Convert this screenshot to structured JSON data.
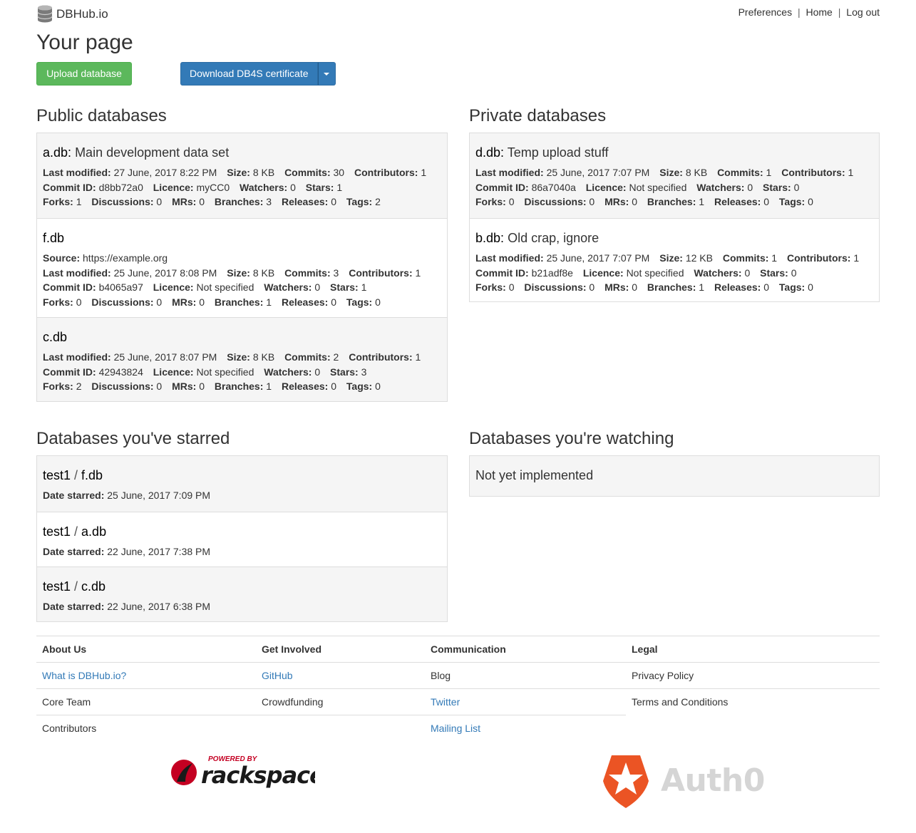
{
  "site": {
    "name": "DBHub.io"
  },
  "topnav": {
    "preferences": "Preferences",
    "home": "Home",
    "logout": "Log out",
    "separator": "|"
  },
  "page": {
    "title": "Your page"
  },
  "buttons": {
    "upload": "Upload database",
    "download_cert": "Download DB4S certificate"
  },
  "labels": {
    "last_modified": "Last modified:",
    "size": "Size:",
    "commits": "Commits:",
    "contributors": "Contributors:",
    "commit_id": "Commit ID:",
    "licence": "Licence:",
    "watchers": "Watchers:",
    "stars": "Stars:",
    "forks": "Forks:",
    "discussions": "Discussions:",
    "mrs": "MRs:",
    "branches": "Branches:",
    "releases": "Releases:",
    "tags": "Tags:",
    "source": "Source:",
    "date_starred": "Date starred:"
  },
  "public": {
    "heading": "Public databases",
    "items": [
      {
        "name": "a.db",
        "sep": ": ",
        "desc": "Main development data set",
        "last_modified": "27 June, 2017 8:22 PM",
        "size": "8 KB",
        "commits": "30",
        "contributors": "1",
        "commit_id": "d8bb72a0",
        "licence": "myCC0",
        "watchers": "0",
        "stars": "1",
        "forks": "1",
        "discussions": "0",
        "mrs": "0",
        "branches": "3",
        "releases": "0",
        "tags": "2"
      },
      {
        "name": "f.db",
        "source": "https://example.org",
        "last_modified": "25 June, 2017 8:08 PM",
        "size": "8 KB",
        "commits": "3",
        "contributors": "1",
        "commit_id": "b4065a97",
        "licence": "Not specified",
        "watchers": "0",
        "stars": "1",
        "forks": "0",
        "discussions": "0",
        "mrs": "0",
        "branches": "1",
        "releases": "0",
        "tags": "0"
      },
      {
        "name": "c.db",
        "last_modified": "25 June, 2017 8:07 PM",
        "size": "8 KB",
        "commits": "2",
        "contributors": "1",
        "commit_id": "42943824",
        "licence": "Not specified",
        "watchers": "0",
        "stars": "3",
        "forks": "2",
        "discussions": "0",
        "mrs": "0",
        "branches": "1",
        "releases": "0",
        "tags": "0"
      }
    ]
  },
  "private": {
    "heading": "Private databases",
    "items": [
      {
        "name": "d.db",
        "sep": ": ",
        "desc": "Temp upload stuff",
        "last_modified": "25 June, 2017 7:07 PM",
        "size": "8 KB",
        "commits": "1",
        "contributors": "1",
        "commit_id": "86a7040a",
        "licence": "Not specified",
        "watchers": "0",
        "stars": "0",
        "forks": "0",
        "discussions": "0",
        "mrs": "0",
        "branches": "1",
        "releases": "0",
        "tags": "0"
      },
      {
        "name": "b.db",
        "sep": ": ",
        "desc": "Old crap, ignore",
        "last_modified": "25 June, 2017 7:07 PM",
        "size": "12 KB",
        "commits": "1",
        "contributors": "1",
        "commit_id": "b21adf8e",
        "licence": "Not specified",
        "watchers": "0",
        "stars": "0",
        "forks": "0",
        "discussions": "0",
        "mrs": "0",
        "branches": "1",
        "releases": "0",
        "tags": "0"
      }
    ]
  },
  "starred": {
    "heading": "Databases you've starred",
    "items": [
      {
        "owner": "test1",
        "slash": " / ",
        "name": "f.db",
        "date": "25 June, 2017 7:09 PM"
      },
      {
        "owner": "test1",
        "slash": " / ",
        "name": "a.db",
        "date": "22 June, 2017 7:38 PM"
      },
      {
        "owner": "test1",
        "slash": " / ",
        "name": "c.db",
        "date": "22 June, 2017 6:38 PM"
      }
    ]
  },
  "watching": {
    "heading": "Databases you're watching",
    "text": "Not yet implemented"
  },
  "footer": {
    "about": {
      "heading": "About Us",
      "items": [
        "What is DBHub.io?",
        "Core Team",
        "Contributors"
      ]
    },
    "involved": {
      "heading": "Get Involved",
      "items": [
        "GitHub",
        "Crowdfunding"
      ]
    },
    "communication": {
      "heading": "Communication",
      "items": [
        "Blog",
        "Twitter",
        "Mailing List"
      ]
    },
    "legal": {
      "heading": "Legal",
      "items": [
        "Privacy Policy",
        "Terms and Conditions"
      ]
    }
  },
  "sponsors": {
    "rackspace_top": "POWERED BY",
    "rackspace": "rackspace",
    "auth0": "Auth0"
  },
  "colors": {
    "link": "#337ab7",
    "success": "#5cb85c",
    "primary": "#337ab7",
    "rackspace_red": "#c40022",
    "auth0_orange": "#eb5424"
  }
}
